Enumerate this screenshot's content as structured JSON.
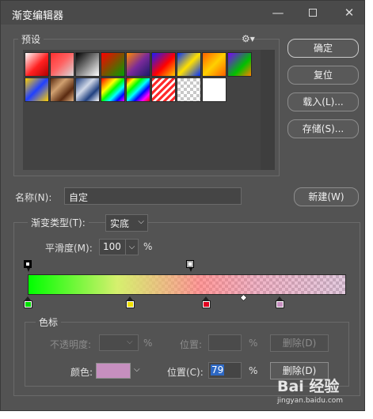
{
  "window": {
    "title": "渐变编辑器",
    "minimize_symbol": "—",
    "close_symbol": "✕"
  },
  "presets": {
    "legend": "预设",
    "gear_icon": "⚙▾",
    "swatches": [
      "linear-gradient(135deg,#ffffff,#ff2020 55%,#b00000)",
      "linear-gradient(135deg,#ff3030,#ff6060 45%,#d8d8d8)",
      "linear-gradient(135deg,#000000,#ffffff)",
      "linear-gradient(135deg,#ff0000,#00a000)",
      "linear-gradient(135deg,#ff8a00,#7a2a9a 50%,#1a1a6a)",
      "linear-gradient(135deg,#1a1aff,#ff0000 55%,#ffcc00)",
      "linear-gradient(135deg,#0030ff,#ffe000 50%,#0030ff)",
      "linear-gradient(135deg,#ff6000,#ffd000 50%,#ff6000)",
      "linear-gradient(135deg,#7a00ff,#00c000 60%,#ff8000)",
      "linear-gradient(135deg,#ffd000,#2040ff 50%,#ffd000)",
      "linear-gradient(135deg,#5a2a10,#d0a070 35%,#5a2a10 70%,#e0b080)",
      "linear-gradient(135deg,#204080,#d0d8e8 40%,#204080 70%,#ffffff)",
      "linear-gradient(135deg,#ff0000,#ff8000,#ffff00,#00ff00,#00ffff,#0000ff,#ff00ff)",
      "linear-gradient(135deg,#ff0000,#ffff00,#00ff00,#00ffff,#0000ff,#ff00ff,#ff0000)",
      "repeating-linear-gradient(135deg,#ff2a2a 0 3px,#ffffff 3px 6px)",
      "repeating-conic-gradient(#c8c8c8 0% 25%,#ffffff 0% 50%) 0 0/8px 8px",
      "#ffffff"
    ]
  },
  "buttons": {
    "ok": "确定",
    "reset": "复位",
    "load": "载入(L)...",
    "save": "存储(S)...",
    "new": "新建(W)"
  },
  "name": {
    "label": "名称(N):",
    "value": "自定"
  },
  "gradient": {
    "type_label": "渐变类型(T):",
    "type_value": "实底",
    "smoothness_label": "平滑度(M):",
    "smoothness_value": "100",
    "percent": "%",
    "opacity_stops": [
      {
        "location": 0,
        "color": "#000000"
      },
      {
        "location": 51,
        "color": "#a8a8a8"
      }
    ],
    "color_stops": [
      {
        "location": 0,
        "color": "#00e000"
      },
      {
        "location": 32,
        "color": "#f0e000"
      },
      {
        "location": 56,
        "color": "#e00020"
      },
      {
        "location": 79,
        "color": "#c68fbf"
      }
    ],
    "midpoint_location": 68
  },
  "stops": {
    "legend": "色标",
    "opacity_label": "不透明度:",
    "opacity_pct": "%",
    "opacity_pos_label": "位置:",
    "opacity_pos_pct": "%",
    "opacity_delete": "删除(D)",
    "color_label": "颜色:",
    "color_value": "#c68fbf",
    "color_pos_label": "位置(C):",
    "color_pos_value": "79",
    "color_pos_pct": "%",
    "color_delete": "删除(D)"
  },
  "watermark": {
    "brand": "Bai 经验",
    "url": "jingyan.baidu.com"
  }
}
